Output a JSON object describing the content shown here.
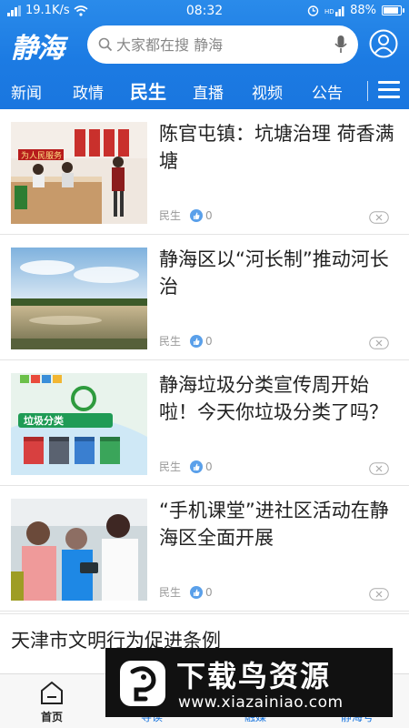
{
  "status_bar": {
    "speed": "19.1K/s",
    "time": "08:32",
    "battery": "88%"
  },
  "header": {
    "logo": "静海",
    "search": {
      "placeholder": "大家都在搜 静海"
    },
    "tabs": [
      "新闻",
      "政情",
      "民生",
      "直播",
      "视频",
      "公告"
    ],
    "active_tab": "民生"
  },
  "feed": {
    "items": [
      {
        "title": "陈官屯镇：坑塘治理 荷香满塘",
        "category": "民生",
        "likes": "0"
      },
      {
        "title": "静海区以“河长制”推动河长治",
        "category": "民生",
        "likes": "0"
      },
      {
        "title": "静海垃圾分类宣传周开始啦！今天你垃圾分类了吗？",
        "category": "民生",
        "likes": "0"
      },
      {
        "title": "“手机课堂”进社区活动在静海区全面开展",
        "category": "民生",
        "likes": "0"
      }
    ],
    "text_only_item": {
      "title": "天津市文明行为促进条例"
    },
    "image_texts": {
      "banner": "为人民服务",
      "sign": "垃圾分类"
    }
  },
  "bottom_nav": {
    "items": [
      "首页",
      "导读",
      "融媒",
      "静海号"
    ],
    "active": "首页"
  },
  "watermark": {
    "title": "下载鸟资源",
    "url": "www.xiazainiao.com"
  },
  "colors": {
    "brand_blue": "#1a76df",
    "text": "#222222",
    "meta_gray": "#999999"
  }
}
